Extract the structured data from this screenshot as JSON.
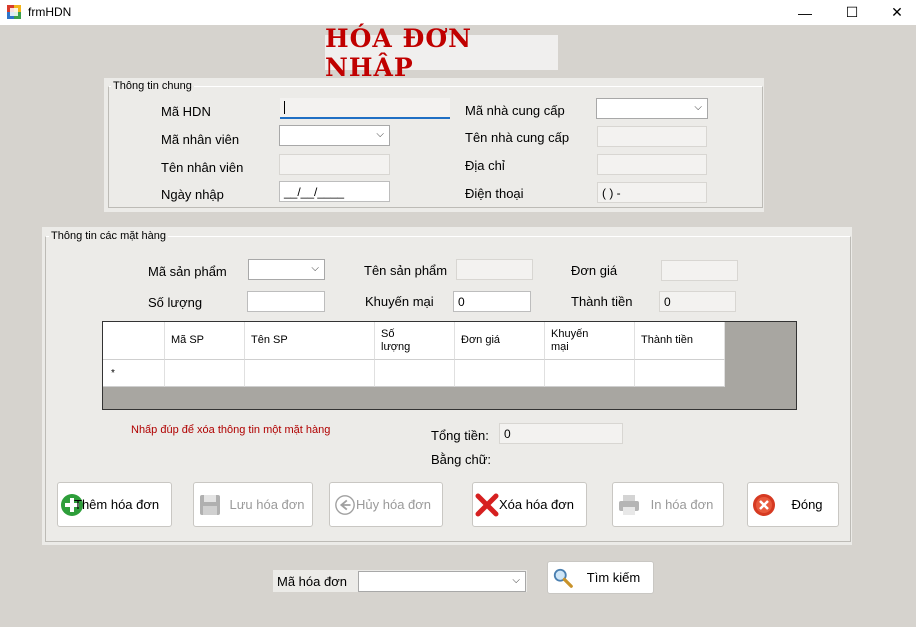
{
  "window": {
    "title": "frmHDN",
    "min_glyph": "—",
    "max_glyph": "☐",
    "close_glyph": "✕"
  },
  "form_title": "HÓA ĐƠN NHẬP",
  "general": {
    "legend": "Thông tin chung",
    "ma_hdn_label": "Mã HDN",
    "ma_nv_label": "Mã nhân viên",
    "ten_nv_label": "Tên nhân viên",
    "ngay_nhap_label": "Ngày nhập",
    "ngay_nhap_value": "__/__/____",
    "ma_ncc_label": "Mã nhà cung cấp",
    "ten_ncc_label": "Tên nhà cung cấp",
    "dia_chi_label": "Địa chỉ",
    "dien_thoai_label": "Điện thoại",
    "dien_thoai_value": "(  )   -"
  },
  "items": {
    "legend": "Thông tin các mặt hàng",
    "ma_sp_label": "Mã sản phẩm",
    "ten_sp_label": "Tên sản phẩm",
    "don_gia_label": "Đơn giá",
    "so_luong_label": "Số lượng",
    "khuyen_mai_label": "Khuyến mại",
    "khuyen_mai_value": "0",
    "thanh_tien_label": "Thành tiền",
    "thanh_tien_value": "0"
  },
  "grid": {
    "columns": [
      "Mã SP",
      "Tên SP",
      "Số lượng",
      "Đơn giá",
      "Khuyến mại",
      "Thành tiền"
    ],
    "new_row_marker": "*"
  },
  "hint": "Nhấp đúp để xóa thông tin một mặt hàng",
  "totals": {
    "tong_tien_label": "Tổng tiền:",
    "tong_tien_value": "0",
    "bang_chu_label": "Bằng chữ:"
  },
  "buttons": {
    "them": "Thêm hóa đơn",
    "luu": "Lưu hóa đơn",
    "huy": "Hủy hóa đơn",
    "xoa": "Xóa hóa đơn",
    "in": "In hóa đơn",
    "dong": "Đóng"
  },
  "search": {
    "label": "Mã hóa đơn",
    "button": "Tìm kiếm"
  },
  "colors": {
    "title_red": "#c00000",
    "hint_red": "#b00000",
    "focus_blue": "#1f6fc4",
    "form_bg": "#d6d3ce"
  }
}
